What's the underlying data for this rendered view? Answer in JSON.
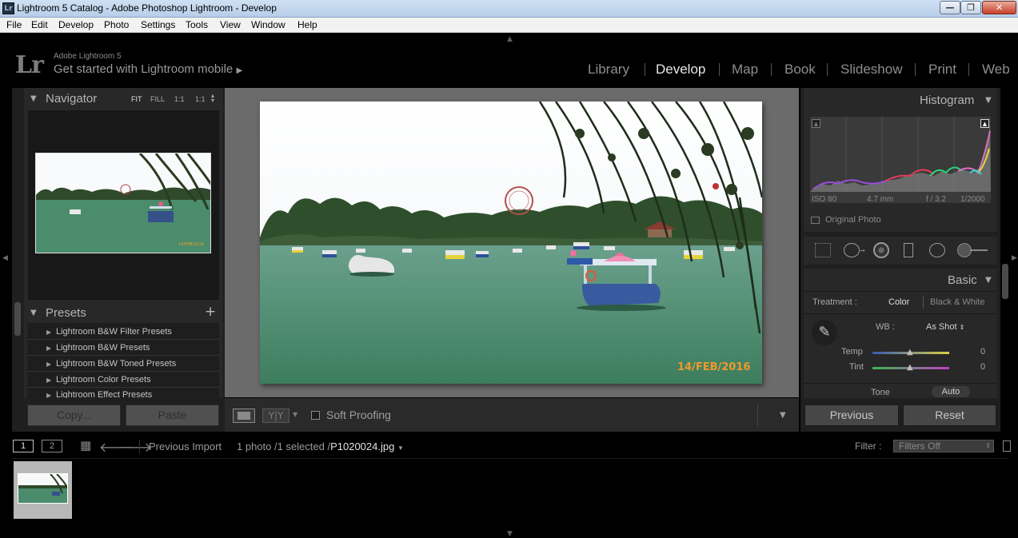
{
  "window": {
    "title": "Lightroom 5 Catalog - Adobe Photoshop Lightroom - Develop",
    "app_icon": "Lr",
    "controls": {
      "minimize": "—",
      "maximize": "❐",
      "close": "✕"
    }
  },
  "menu": [
    "File",
    "Edit",
    "Develop",
    "Photo",
    "Settings",
    "Tools",
    "View",
    "Window",
    "Help"
  ],
  "header": {
    "logo": "Lr",
    "app_name": "Adobe Lightroom 5",
    "mobile_link": "Get started with Lightroom mobile",
    "modules": [
      "Library",
      "Develop",
      "Map",
      "Book",
      "Slideshow",
      "Print",
      "Web"
    ],
    "active_module": "Develop"
  },
  "navigator": {
    "title": "Navigator",
    "zoom_options": [
      "FIT",
      "FILL",
      "1:1",
      "1:1"
    ]
  },
  "presets": {
    "title": "Presets",
    "add": "+",
    "items": [
      "Lightroom B&W Filter Presets",
      "Lightroom B&W Presets",
      "Lightroom B&W Toned Presets",
      "Lightroom Color Presets",
      "Lightroom Effect Presets"
    ]
  },
  "left_buttons": {
    "copy": "Copy...",
    "paste": "Paste"
  },
  "photo": {
    "date_stamp": "14/FEB/2016"
  },
  "toolbar": {
    "soft_proofing": "Soft Proofing"
  },
  "histogram": {
    "title": "Histogram",
    "iso": "ISO 80",
    "focal": "4.7 mm",
    "aperture": "f / 3.2",
    "shutter": "1/2000",
    "original_photo": "Original Photo"
  },
  "basic": {
    "title": "Basic",
    "treatment_label": "Treatment :",
    "treatment_color": "Color",
    "treatment_bw": "Black & White",
    "wb_label": "WB :",
    "wb_value": "As Shot",
    "temp_label": "Temp",
    "temp_value": "0",
    "tint_label": "Tint",
    "tint_value": "0",
    "tone_label": "Tone",
    "auto": "Auto"
  },
  "right_buttons": {
    "previous": "Previous",
    "reset": "Reset"
  },
  "filmstrip": {
    "view1": "1",
    "view2": "2",
    "source": "Previous Import",
    "count": "1 photo /1 selected /",
    "filename": "P1020024.jpg",
    "filter_label": "Filter :",
    "filter_value": "Filters Off"
  },
  "colors": {
    "accent_text": "#e8e8e8",
    "panel": "#282828",
    "date_stamp": "#f09a2a"
  }
}
